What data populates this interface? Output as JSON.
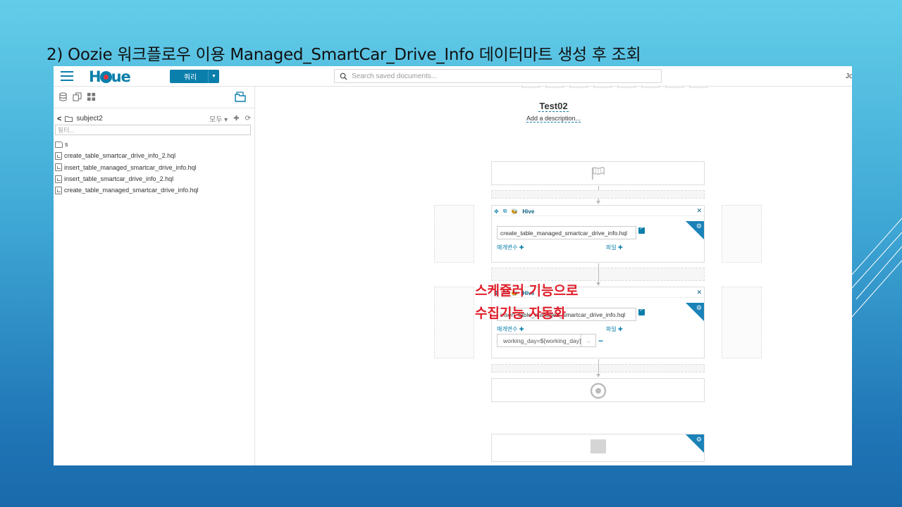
{
  "slide": {
    "title": "2) Oozie 워크플로우 이용 Managed_SmartCar_Drive_Info 데이터마트 생성 후 조회"
  },
  "topnav": {
    "logo_text": "HUE",
    "query_button": "쿼리",
    "search_placeholder": "Search saved documents...",
    "user": "Jo"
  },
  "sidebar": {
    "breadcrumb": "subject2",
    "filter_menu": "모두",
    "filter_placeholder": "필터...",
    "files": [
      {
        "name": "s",
        "type": "folder"
      },
      {
        "name": "create_table_smartcar_drive_info_2.hql",
        "type": "file"
      },
      {
        "name": "insert_table_managed_smartcar_drive_info.hql",
        "type": "file"
      },
      {
        "name": "insert_table_smartcar_drive_info_2.hql",
        "type": "file"
      },
      {
        "name": "create_table_managed_smartcar_drive_info.hql",
        "type": "file"
      }
    ]
  },
  "workflow": {
    "title": "Test02",
    "description": "Add a description...",
    "actions": [
      {
        "type_label": "Hive",
        "script": "create_table_managed_smartcar_drive_info.hql",
        "params_label": "매개변수",
        "files_label": "파일"
      },
      {
        "type_label": "Hive",
        "script": "insert_table_managed_smartcar_drive_info.hql",
        "params_label": "매개변수",
        "files_label": "파일",
        "param_value": "working_day=${working_day}",
        "param_more": ".."
      }
    ]
  },
  "annotation": {
    "line1": "스케쥴러 기능으로",
    "line2": "수집기능 자동화"
  },
  "colors": {
    "accent": "#0b7fab",
    "annotation": "#e01e2a"
  }
}
